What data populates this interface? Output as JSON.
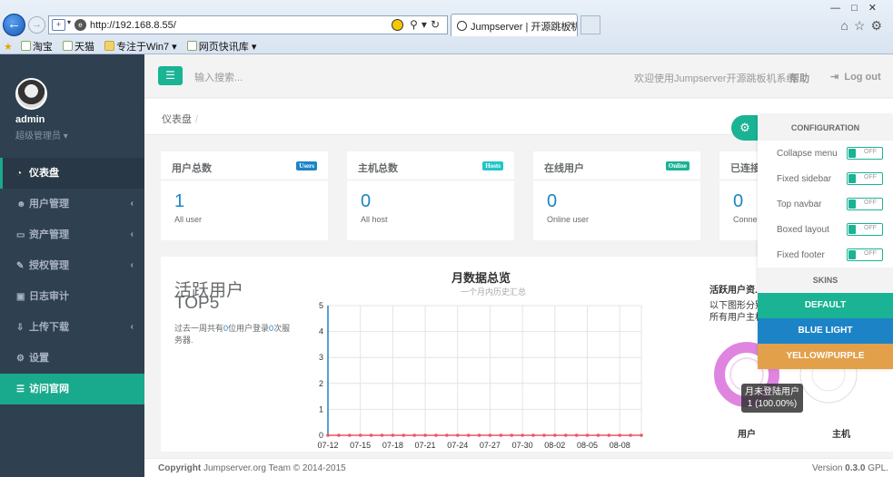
{
  "browser": {
    "url": "http://192.168.8.55/",
    "tab_title": "Jumpserver | 开源跳板机...",
    "favorites": [
      "淘宝",
      "天猫",
      "专注于Win7 ▾",
      "网页快讯库 ▾"
    ]
  },
  "sidebar": {
    "user_name": "admin",
    "user_role": "超级管理员 ▾",
    "items": [
      {
        "label": "仪表盘",
        "icon": "dashboard-icon"
      },
      {
        "label": "用户管理",
        "icon": "users-icon"
      },
      {
        "label": "资产管理",
        "icon": "server-icon"
      },
      {
        "label": "授权管理",
        "icon": "edit-icon"
      },
      {
        "label": "日志审计",
        "icon": "log-icon"
      },
      {
        "label": "上传下载",
        "icon": "download-icon"
      },
      {
        "label": "设置",
        "icon": "gears-icon"
      },
      {
        "label": "访问官网",
        "icon": "database-icon"
      }
    ]
  },
  "topbar": {
    "search_placeholder": "输入搜索...",
    "welcome": "欢迎使用Jumpserver开源跳板机系统",
    "help": "帮助",
    "logout": "Log out"
  },
  "breadcrumb": "仪表盘",
  "cards": [
    {
      "title": "用户总数",
      "badge": "Users",
      "badge_color": "#1c84c6",
      "value": "1",
      "sub": "All user"
    },
    {
      "title": "主机总数",
      "badge": "Hosts",
      "badge_color": "#23c6c8",
      "value": "0",
      "sub": "All host"
    },
    {
      "title": "在线用户",
      "badge": "Online",
      "badge_color": "#1ab394",
      "value": "0",
      "sub": "Online user"
    },
    {
      "title": "已连接",
      "badge": "",
      "badge_color": "#f8ac59",
      "value": "0",
      "sub": "Connec"
    }
  ],
  "top5": {
    "title1": "活跃用户",
    "title2": "TOP5",
    "desc_pre": "过去一周共有",
    "desc_num1": "0",
    "desc_mid": "位用户登录",
    "desc_num2": "0",
    "desc_post": "次服务器."
  },
  "chart_data": {
    "type": "line",
    "title": "月数据总览",
    "subtitle": "一个月内历史汇总",
    "x": [
      "07-12",
      "07-13",
      "07-14",
      "07-15",
      "07-16",
      "07-17",
      "07-18",
      "07-19",
      "07-20",
      "07-21",
      "07-22",
      "07-23",
      "07-24",
      "07-25",
      "07-26",
      "07-27",
      "07-28",
      "07-29",
      "07-30",
      "07-31",
      "08-01",
      "08-02",
      "08-03",
      "08-04",
      "08-05",
      "08-06",
      "08-07",
      "08-08",
      "08-09",
      "08-10"
    ],
    "x_tick_labels": [
      "07-12",
      "07-15",
      "07-18",
      "07-21",
      "07-24",
      "07-27",
      "07-30",
      "08-02",
      "08-05",
      "08-08"
    ],
    "series": [
      {
        "values": [
          0,
          0,
          0,
          0,
          0,
          0,
          0,
          0,
          0,
          0,
          0,
          0,
          0,
          0,
          0,
          0,
          0,
          0,
          0,
          0,
          0,
          0,
          0,
          0,
          0,
          0,
          0,
          0,
          0,
          0
        ],
        "color": "#ed5565"
      }
    ],
    "ylim": [
      0,
      5
    ],
    "yticks": [
      0,
      1,
      2,
      3,
      4,
      5
    ],
    "grid": true
  },
  "right_panel": {
    "title": "活跃用户资...",
    "desc1": "以下图形分别...",
    "desc2": "所有用户主机...",
    "tooltip_line1": "月未登陆用户",
    "tooltip_line2": "1 (100.00%)",
    "label_user": "用户",
    "label_host": "主机"
  },
  "config": {
    "header": "CONFIGURATION",
    "options": [
      "Collapse menu",
      "Fixed sidebar",
      "Top navbar",
      "Boxed layout",
      "Fixed footer"
    ],
    "off_label": "OFF",
    "skins_header": "SKINS",
    "skins": [
      "DEFAULT",
      "BLUE LIGHT",
      "YELLOW/PURPLE"
    ]
  },
  "footer": {
    "copyright_bold": "Copyright",
    "copyright": " Jumpserver.org Team © 2014-2015",
    "version_pre": "Version ",
    "version_num": "0.3.0",
    "version_post": " GPL."
  }
}
